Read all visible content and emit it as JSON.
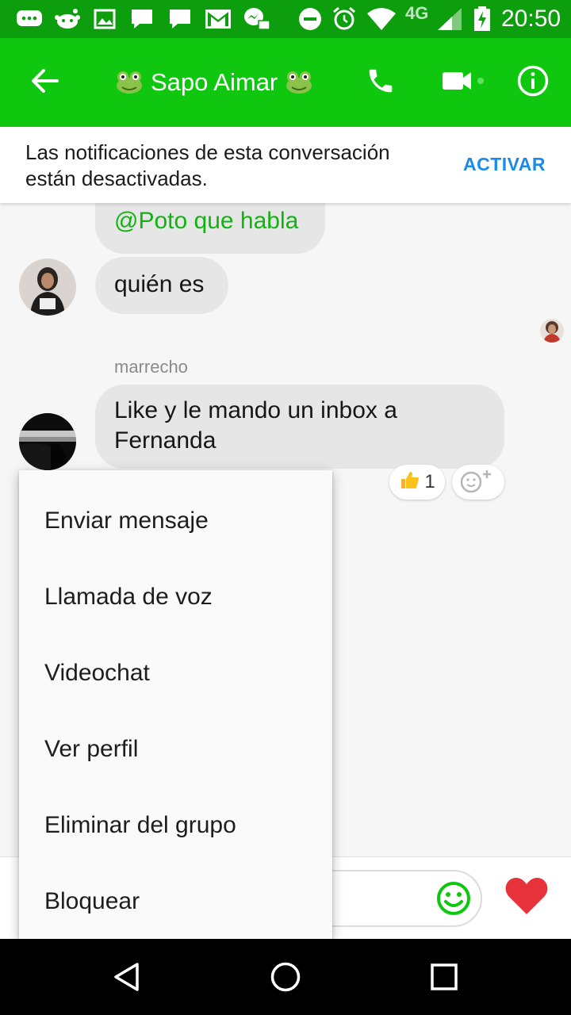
{
  "status_bar": {
    "time": "20:50",
    "network": "4G",
    "icons": [
      "chat-bubbles-icon",
      "reddit-icon",
      "image-icon",
      "message-icon",
      "message-icon",
      "gmail-icon",
      "messenger-icon",
      "do-not-disturb-icon",
      "alarm-icon",
      "wifi-icon",
      "signal-icon",
      "battery-charging-icon"
    ]
  },
  "header": {
    "back_icon": "arrow-left-icon",
    "title": "Sapo Aimar",
    "title_emoji": "frog-emoji",
    "call_icon": "phone-icon",
    "video_icon": "video-camera-icon",
    "info_icon": "info-icon",
    "accent": "#10c710"
  },
  "notice": {
    "text": "Las notificaciones de esta conversación están desactivadas.",
    "action": "ACTIVAR"
  },
  "messages": {
    "mention_text": "@Poto que habla",
    "quien": "quién es",
    "sender_name": "marrecho",
    "like_text": "Like y le mando un inbox a Fernanda",
    "reaction_count": "1",
    "reaction_icon": "thumbs-up-icon",
    "add_reaction_icon": "add-reaction-icon"
  },
  "composer": {
    "emoji_icon": "smiley-icon",
    "send_icon": "heart-icon"
  },
  "menu": {
    "items": [
      "Enviar mensaje",
      "Llamada de voz",
      "Videochat",
      "Ver perfil",
      "Eliminar del grupo",
      "Bloquear"
    ]
  },
  "nav": {
    "back": "triangle-back-icon",
    "home": "circle-home-icon",
    "recents": "square-recents-icon"
  }
}
